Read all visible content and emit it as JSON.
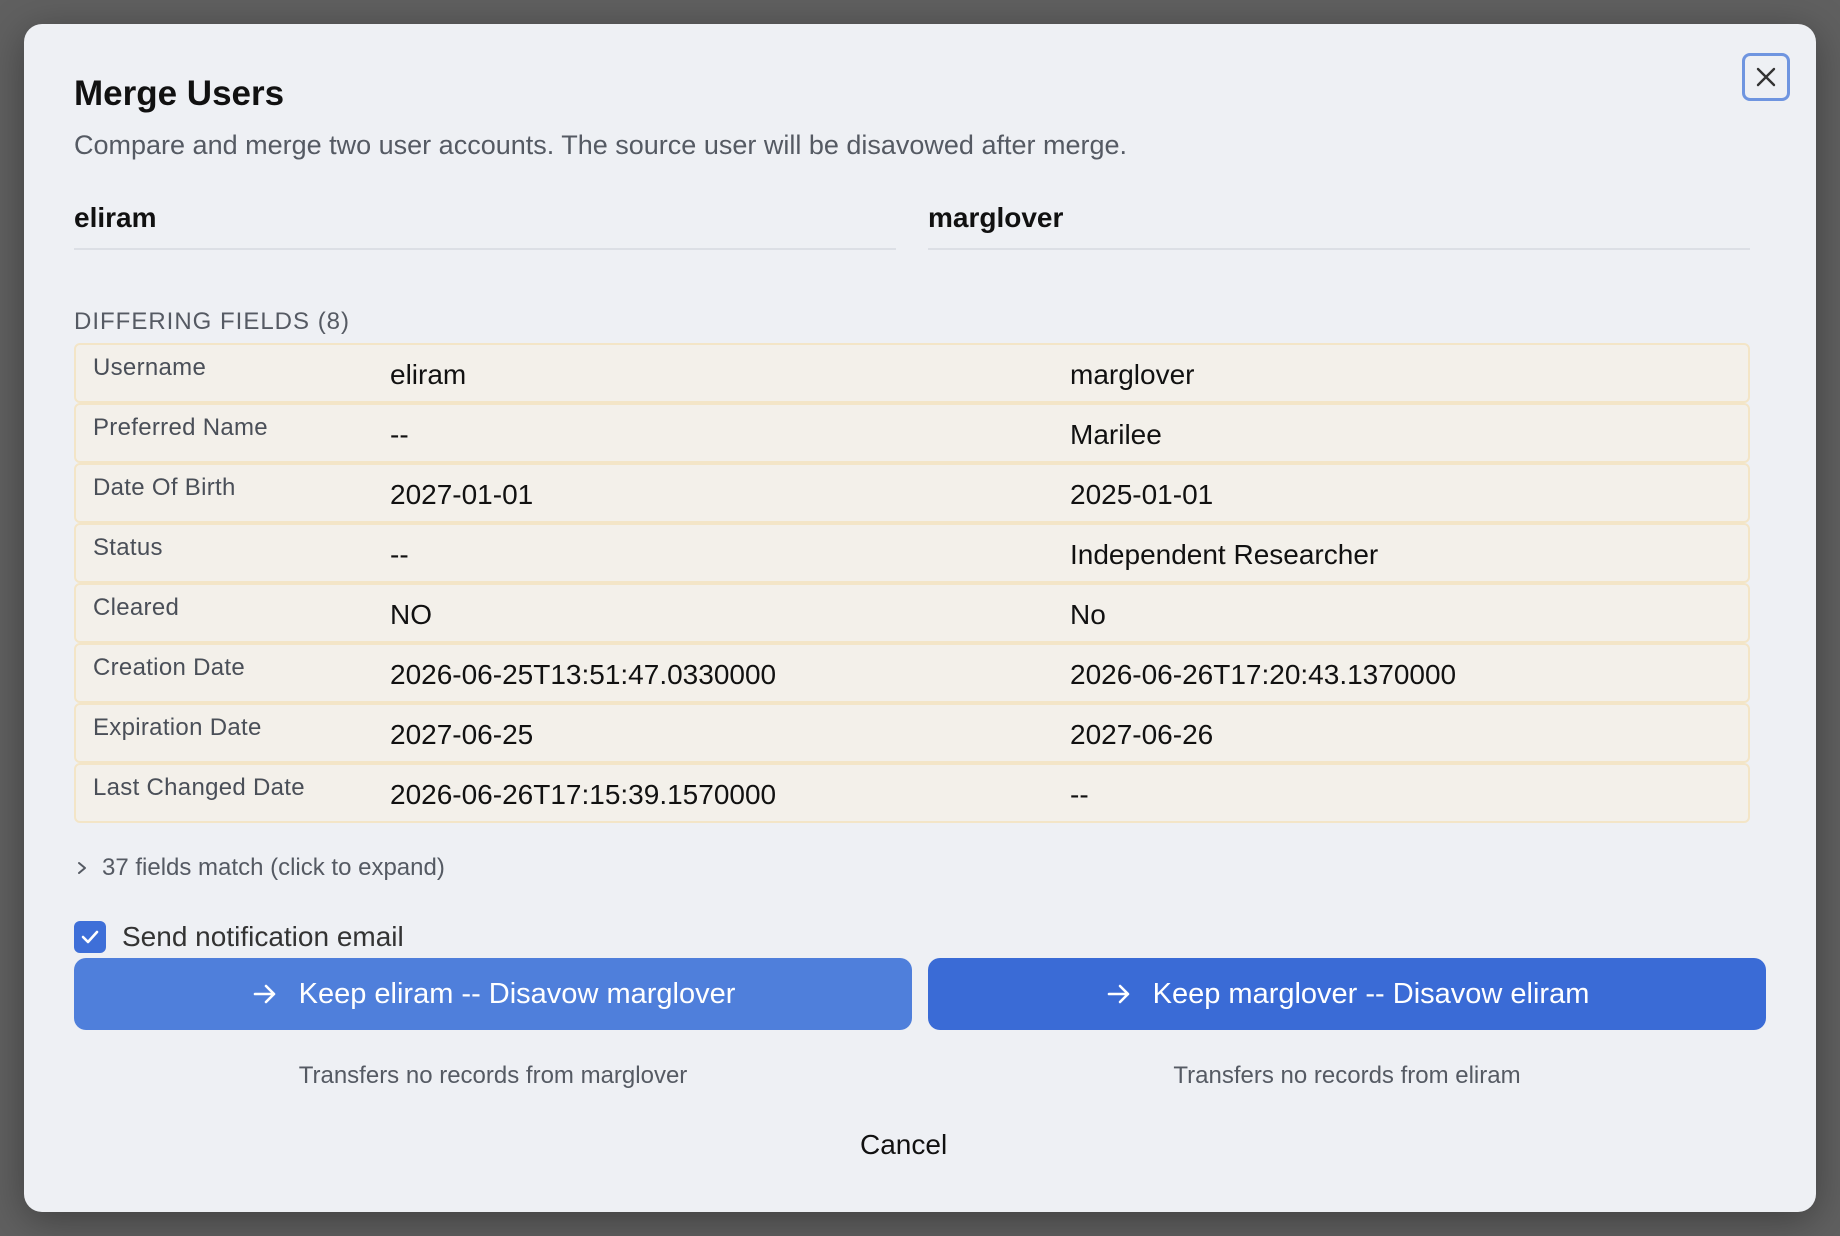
{
  "dialog": {
    "title": "Merge Users",
    "subtitle": "Compare and merge two user accounts. The source user will be disavowed after merge."
  },
  "users": {
    "left": "eliram",
    "right": "marglover"
  },
  "differing": {
    "label": "DIFFERING FIELDS (8)",
    "rows": [
      {
        "field": "Username",
        "a": "eliram",
        "b": "marglover"
      },
      {
        "field": "Preferred Name",
        "a": "--",
        "b": "Marilee"
      },
      {
        "field": "Date Of Birth",
        "a": "2027-01-01",
        "b": "2025-01-01"
      },
      {
        "field": "Status",
        "a": "--",
        "b": "Independent Researcher"
      },
      {
        "field": "Cleared",
        "a": "NO",
        "b": "No"
      },
      {
        "field": "Creation Date",
        "a": "2026-06-25T13:51:47.0330000",
        "b": "2026-06-26T17:20:43.1370000"
      },
      {
        "field": "Expiration Date",
        "a": "2027-06-25",
        "b": "2027-06-26"
      },
      {
        "field": "Last Changed Date",
        "a": "2026-06-26T17:15:39.1570000",
        "b": "--"
      }
    ]
  },
  "matching": {
    "label": "37 fields match (click to expand)"
  },
  "notify": {
    "label": "Send notification email",
    "checked": true
  },
  "actions": {
    "keep_left": "Keep eliram -- Disavow marglover",
    "keep_left_note": "Transfers no records from marglover",
    "keep_right": "Keep marglover -- Disavow eliram",
    "keep_right_note": "Transfers no records from eliram",
    "cancel": "Cancel"
  },
  "colors": {
    "accent": "#3a6bd6",
    "row_bg": "#f3f0ea",
    "row_border": "#f3e5c7"
  },
  "icons": {
    "close": "close-icon",
    "chevron": "chevron-right-icon",
    "check": "checkmark-icon",
    "arrow": "arrow-right-icon"
  }
}
